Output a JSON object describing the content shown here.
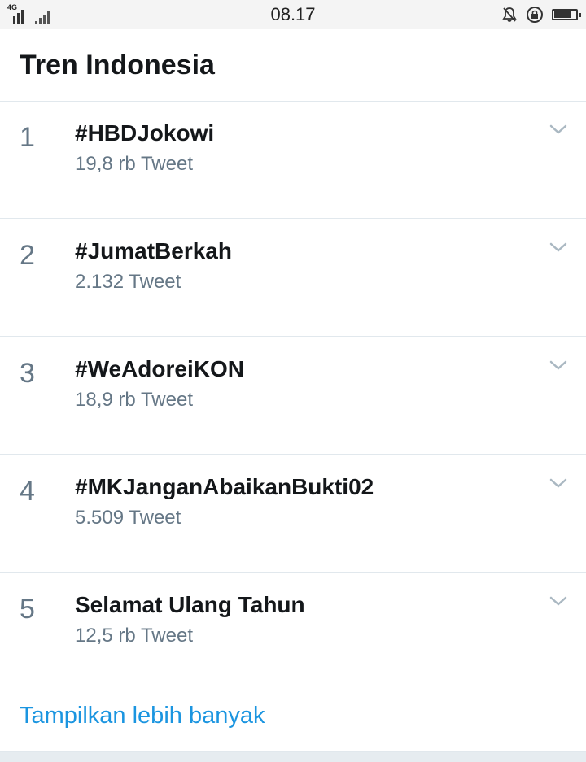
{
  "status_bar": {
    "network": "4G",
    "time": "08.17",
    "icons": [
      "signal-icon",
      "mute-notifications-icon",
      "rotation-lock-icon",
      "battery-icon"
    ]
  },
  "header": {
    "title": "Tren Indonesia"
  },
  "trends": [
    {
      "rank": "1",
      "name": "#HBDJokowi",
      "count": "19,8 rb Tweet"
    },
    {
      "rank": "2",
      "name": "#JumatBerkah",
      "count": "2.132 Tweet"
    },
    {
      "rank": "3",
      "name": "#WeAdoreiKON",
      "count": "18,9 rb Tweet"
    },
    {
      "rank": "4",
      "name": "#MKJanganAbaikanBukti02",
      "count": "5.509 Tweet"
    },
    {
      "rank": "5",
      "name": "Selamat Ulang Tahun",
      "count": "12,5 rb Tweet"
    }
  ],
  "show_more": {
    "label": "Tampilkan lebih banyak"
  },
  "colors": {
    "accent": "#1b95e0",
    "secondary_text": "#657786",
    "divider": "#e1e8ed"
  }
}
